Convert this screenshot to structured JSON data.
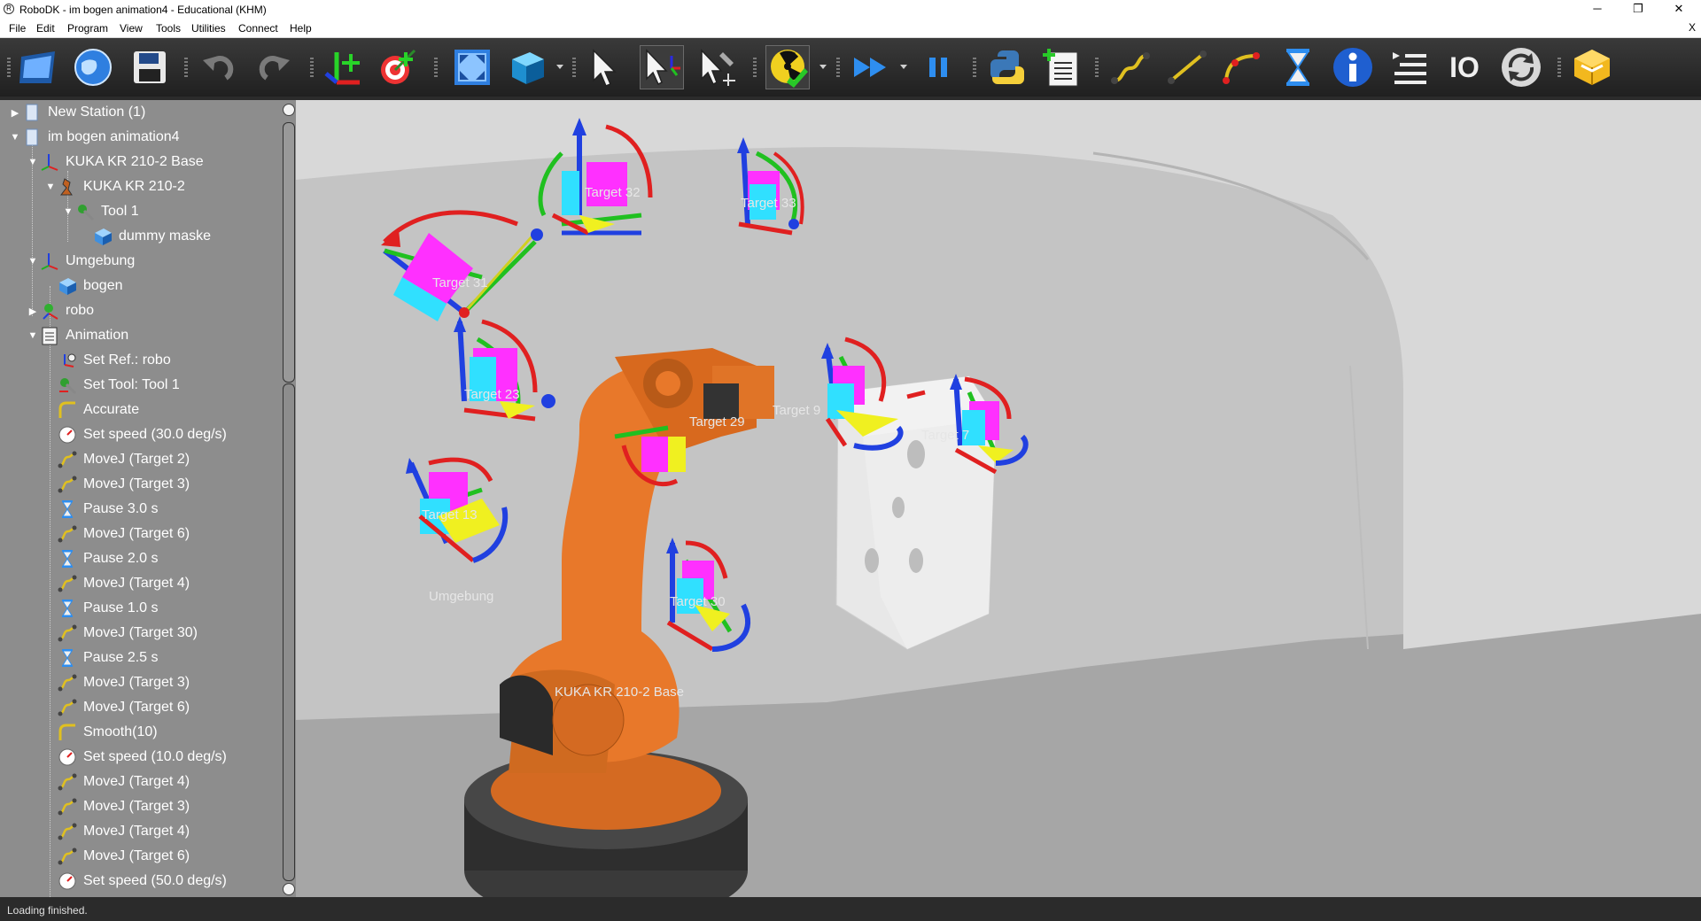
{
  "window": {
    "title": "RoboDK - im bogen animation4 - Educational (KHM)",
    "minimize": "─",
    "maximize": "❐",
    "close": "✕"
  },
  "menu": {
    "items": [
      "File",
      "Edit",
      "Program",
      "View",
      "Tools",
      "Utilities",
      "Connect",
      "Help"
    ],
    "close_doc": "X"
  },
  "toolbar": {
    "icons": [
      "open-station-icon",
      "open-online-library-icon",
      "save-station-icon",
      "undo-icon",
      "redo-icon",
      "add-reference-frame-icon",
      "add-target-icon",
      "fit-all-icon",
      "view-iso-icon",
      "select-icon",
      "move-reference-icon",
      "move-tool-icon",
      "collision-check-icon",
      "fast-simulation-icon",
      "pause-simulation-icon",
      "python-icon",
      "add-program-icon",
      "move-joint-icon",
      "move-linear-icon",
      "move-circular-icon",
      "pause-instruction-icon",
      "message-info-icon",
      "program-call-icon",
      "io-icon",
      "refresh-icon",
      "package-icon"
    ],
    "io_label": "IO"
  },
  "tree": {
    "items": [
      {
        "label": "New Station (1)",
        "icon": "station-icon"
      },
      {
        "label": "im bogen animation4",
        "icon": "station-icon"
      },
      {
        "label": "KUKA KR 210-2 Base",
        "icon": "reference-frame-icon"
      },
      {
        "label": "KUKA KR 210-2",
        "icon": "robot-icon"
      },
      {
        "label": "Tool 1",
        "icon": "tool-icon"
      },
      {
        "label": "dummy maske",
        "icon": "object-icon"
      },
      {
        "label": "Umgebung",
        "icon": "reference-frame-icon"
      },
      {
        "label": "bogen",
        "icon": "object-icon"
      },
      {
        "label": "robo",
        "icon": "reference-frame-icon"
      },
      {
        "label": "Animation",
        "icon": "program-icon"
      },
      {
        "label": "Set Ref.: robo",
        "icon": "set-reference-icon"
      },
      {
        "label": "Set Tool: Tool 1",
        "icon": "set-tool-icon"
      },
      {
        "label": "Accurate",
        "icon": "rounding-icon"
      },
      {
        "label": "Set speed (30.0 deg/s)",
        "icon": "speed-icon"
      },
      {
        "label": "MoveJ (Target 2)",
        "icon": "movej-icon"
      },
      {
        "label": "MoveJ (Target 3)",
        "icon": "movej-icon"
      },
      {
        "label": "Pause 3.0 s",
        "icon": "pause-icon"
      },
      {
        "label": "MoveJ (Target 6)",
        "icon": "movej-icon"
      },
      {
        "label": "Pause 2.0 s",
        "icon": "pause-icon"
      },
      {
        "label": "MoveJ (Target 4)",
        "icon": "movej-icon"
      },
      {
        "label": "Pause 1.0 s",
        "icon": "pause-icon"
      },
      {
        "label": "MoveJ (Target 30)",
        "icon": "movej-icon"
      },
      {
        "label": "Pause 2.5 s",
        "icon": "pause-icon"
      },
      {
        "label": "MoveJ (Target 3)",
        "icon": "movej-icon"
      },
      {
        "label": "MoveJ (Target 6)",
        "icon": "movej-icon"
      },
      {
        "label": "Smooth(10)",
        "icon": "rounding-icon"
      },
      {
        "label": "Set speed (10.0 deg/s)",
        "icon": "speed-icon"
      },
      {
        "label": "MoveJ (Target 4)",
        "icon": "movej-icon"
      },
      {
        "label": "MoveJ (Target 3)",
        "icon": "movej-icon"
      },
      {
        "label": "MoveJ (Target 4)",
        "icon": "movej-icon"
      },
      {
        "label": "MoveJ (Target 6)",
        "icon": "movej-icon"
      },
      {
        "label": "Set speed (50.0 deg/s)",
        "icon": "speed-icon"
      }
    ]
  },
  "viewport": {
    "labels": {
      "target31": "Target 31",
      "target32": "Target 32",
      "target33": "Target 33",
      "target23": "Target 23",
      "target29": "Target 29",
      "target9": "Target 9",
      "target7": "Target 7",
      "target13": "Target 13",
      "target30": "Target 30",
      "umgebung": "Umgebung",
      "base": "KUKA KR 210-2 Base"
    }
  },
  "status": {
    "text": "Loading finished."
  },
  "colors": {
    "robot": "#e8782a",
    "tree_bg": "#8d8d8d",
    "toolbar_bg": "#2a2a2a"
  }
}
